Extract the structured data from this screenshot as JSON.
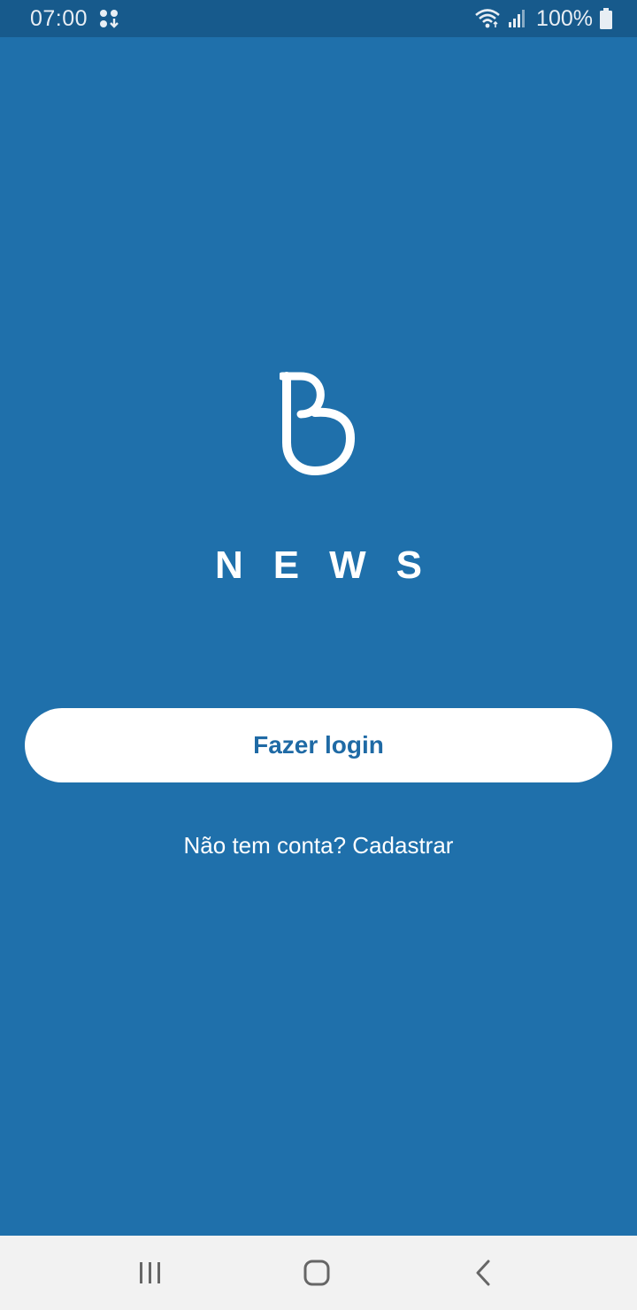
{
  "status_bar": {
    "time": "07:00",
    "notification_icon": "notification-dots-icon",
    "wifi_icon": "wifi-icon",
    "signal_icon": "cell-signal-icon",
    "battery_percent": "100%",
    "battery_icon": "battery-full-icon"
  },
  "brand": {
    "logo_icon": "b-logo-icon",
    "name": "NEWS"
  },
  "actions": {
    "login_label": "Fazer login",
    "signup_label": "Não tem conta? Cadastrar"
  },
  "nav": {
    "recents_icon": "recents-icon",
    "home_icon": "home-icon",
    "back_icon": "back-icon"
  },
  "colors": {
    "background": "#1f70ab",
    "status_bar": "#175a8c",
    "button_background": "#ffffff",
    "button_text": "#1f6aa5",
    "nav_bar": "#f2f2f2"
  }
}
